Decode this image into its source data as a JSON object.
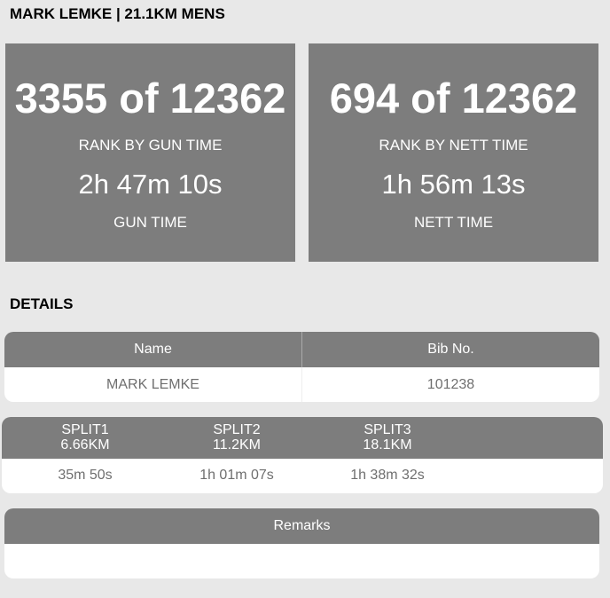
{
  "header": {
    "title": "MARK LEMKE | 21.1KM MENS"
  },
  "gun": {
    "rank": "3355 of 12362",
    "rank_label": "RANK BY GUN TIME",
    "time": "2h 47m 10s",
    "time_label": "GUN TIME"
  },
  "nett": {
    "rank": "694 of 12362",
    "rank_label": "RANK BY NETT TIME",
    "time": "1h 56m 13s",
    "time_label": "NETT TIME"
  },
  "details": {
    "title": "DETAILS",
    "columns": [
      "Name",
      "Bib No."
    ],
    "values": [
      "MARK LEMKE",
      "101238"
    ]
  },
  "splits": [
    {
      "name": "SPLIT1",
      "distance": "6.66KM",
      "time": "35m 50s"
    },
    {
      "name": "SPLIT2",
      "distance": "11.2KM",
      "time": "1h 01m 07s"
    },
    {
      "name": "SPLIT3",
      "distance": "18.1KM",
      "time": "1h 38m 32s"
    }
  ],
  "remarks": {
    "header": "Remarks",
    "value": ""
  },
  "colors": {
    "card": "#7d7d7d",
    "background": "#e8e8e8",
    "muted_text": "#6f6f6f"
  }
}
